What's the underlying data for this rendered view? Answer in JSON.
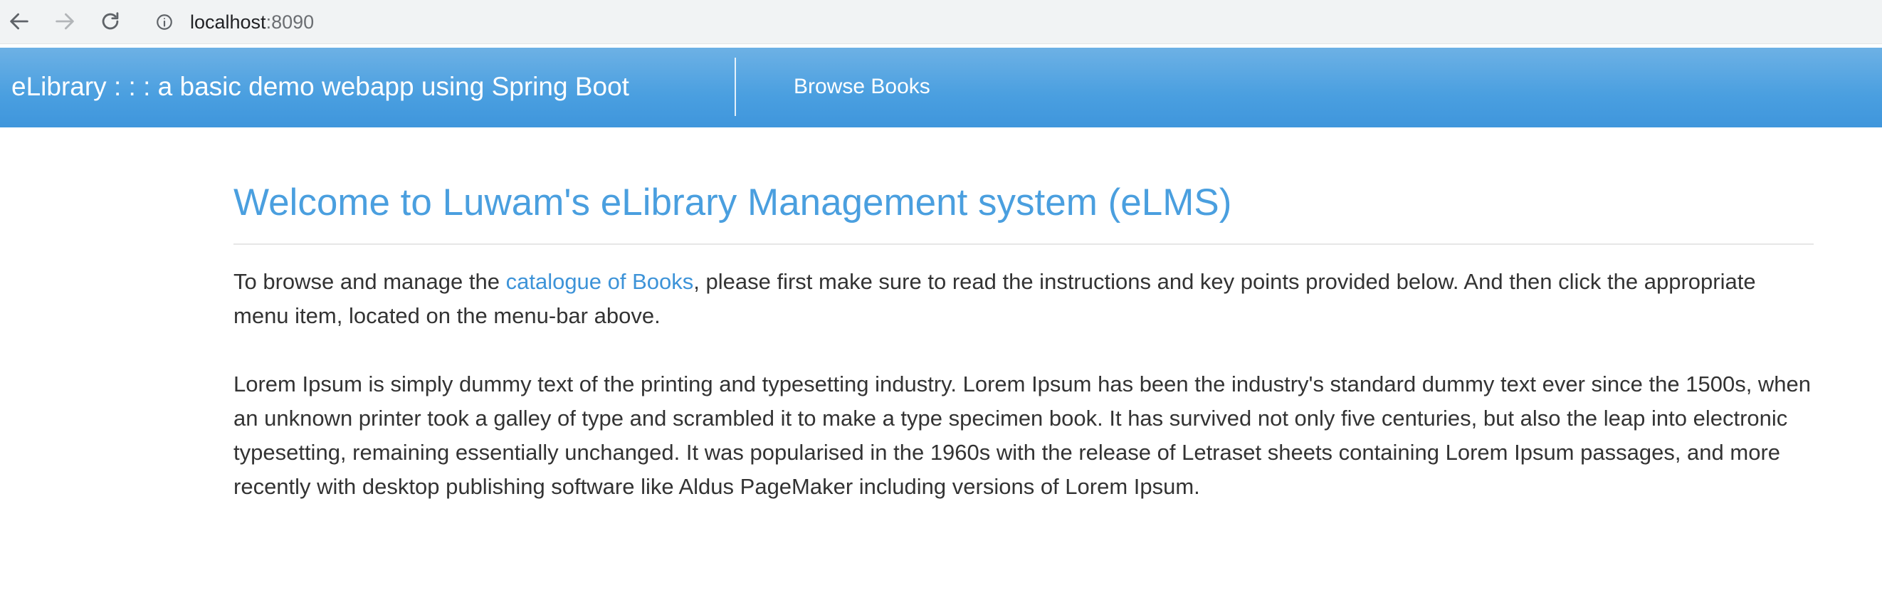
{
  "browser": {
    "url_host": "localhost",
    "url_port": ":8090"
  },
  "navbar": {
    "brand": "eLibrary : : : a basic demo webapp using Spring Boot",
    "browse_books": "Browse Books"
  },
  "main": {
    "title": "Welcome to Luwam's eLibrary Management system (eLMS)",
    "intro_before": "To browse and manage the ",
    "intro_link": "catalogue of Books",
    "intro_after": ", please first make sure to read the instructions and key points provided below. And then click the appropriate menu item, located on the menu-bar above.",
    "lorem": "Lorem Ipsum is simply dummy text of the printing and typesetting industry. Lorem Ipsum has been the industry's standard dummy text ever since the 1500s, when an unknown printer took a galley of type and scrambled it to make a type specimen book. It has survived not only five centuries, but also the leap into electronic typesetting, remaining essentially unchanged. It was popularised in the 1960s with the release of Letraset sheets containing Lorem Ipsum passages, and more recently with desktop publishing software like Aldus PageMaker including versions of Lorem Ipsum."
  },
  "icons": {
    "back": "arrow-left-icon",
    "forward": "arrow-right-icon",
    "reload": "reload-icon",
    "site_info": "info-icon"
  },
  "colors": {
    "navbar": "#4a9fe0",
    "title": "#4a9fdf",
    "link": "#3d93d8",
    "text": "#333333"
  }
}
